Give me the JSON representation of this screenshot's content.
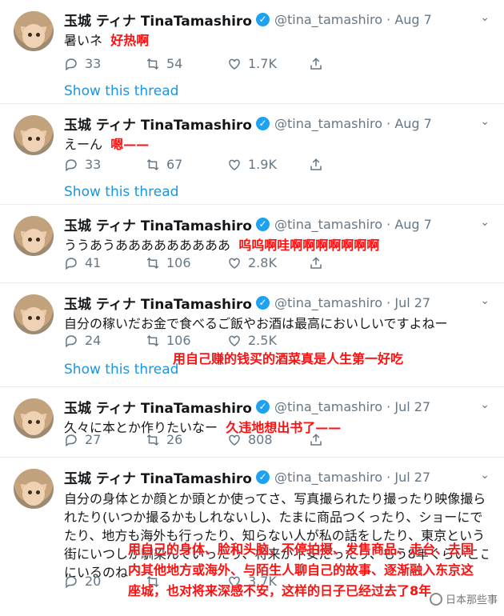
{
  "user": {
    "name": "玉城 ティナ TinaTamashiro",
    "handle": "@tina_tamashiro"
  },
  "show_thread_label": "Show this thread",
  "colors": {
    "link": "#1b95e0",
    "meta": "#657786",
    "verified": "#1da1f2",
    "translation": "#ff1010"
  },
  "tweets": [
    {
      "date": "Aug 7",
      "text": "暑いネ",
      "translation": "好热啊",
      "replies": "33",
      "retweets": "54",
      "likes": "1.7K"
    },
    {
      "date": "Aug 7",
      "text": "えーん",
      "translation": "嗯——",
      "replies": "33",
      "retweets": "67",
      "likes": "1.9K"
    },
    {
      "date": "Aug 7",
      "text": "ううあうあああああああああ",
      "translation": "呜呜啊哇啊啊啊啊啊啊啊",
      "replies": "41",
      "retweets": "106",
      "likes": "2.8K"
    },
    {
      "date": "Jul 27",
      "text": "自分の稼いだお金で食べるご飯やお酒は最高においしいですよねー",
      "translation": "用自己赚的钱买的酒菜真是人生第一好吃",
      "replies": "24",
      "retweets": "106",
      "likes": "2.5K"
    },
    {
      "date": "Jul 27",
      "text": "久々に本とか作りたいなー",
      "translation": "久违地想出书了——",
      "replies": "27",
      "retweets": "26",
      "likes": "808"
    },
    {
      "date": "Jul 27",
      "lines": [
        "自分の身体とか顔とか頭とか使ってさ、写真撮られたり撮ったり映像撮ら",
        "れたり(いつか撮るかもしれないし)、たまに商品つくったり、ショーにで",
        "たり、地方も海外も行ったり、知らない人が私の話をしたり、東京という",
        "街にいつしか馴染んでいったり、将来が不安だったり、もう8年くらいここ",
        "にいるのね"
      ],
      "translation_lines": [
        "用自己的身体、脸和头脑，不停拍摄、发售商品、走台、去国",
        "内其他地方或海外、与陌生人聊自己的故事、逐渐融入东京这",
        "座城，也对将来深感不安，这样的日子已经过去了8年"
      ],
      "replies": "20",
      "retweets": "",
      "likes": "3.7K"
    }
  ],
  "watermark": "日本那些事"
}
